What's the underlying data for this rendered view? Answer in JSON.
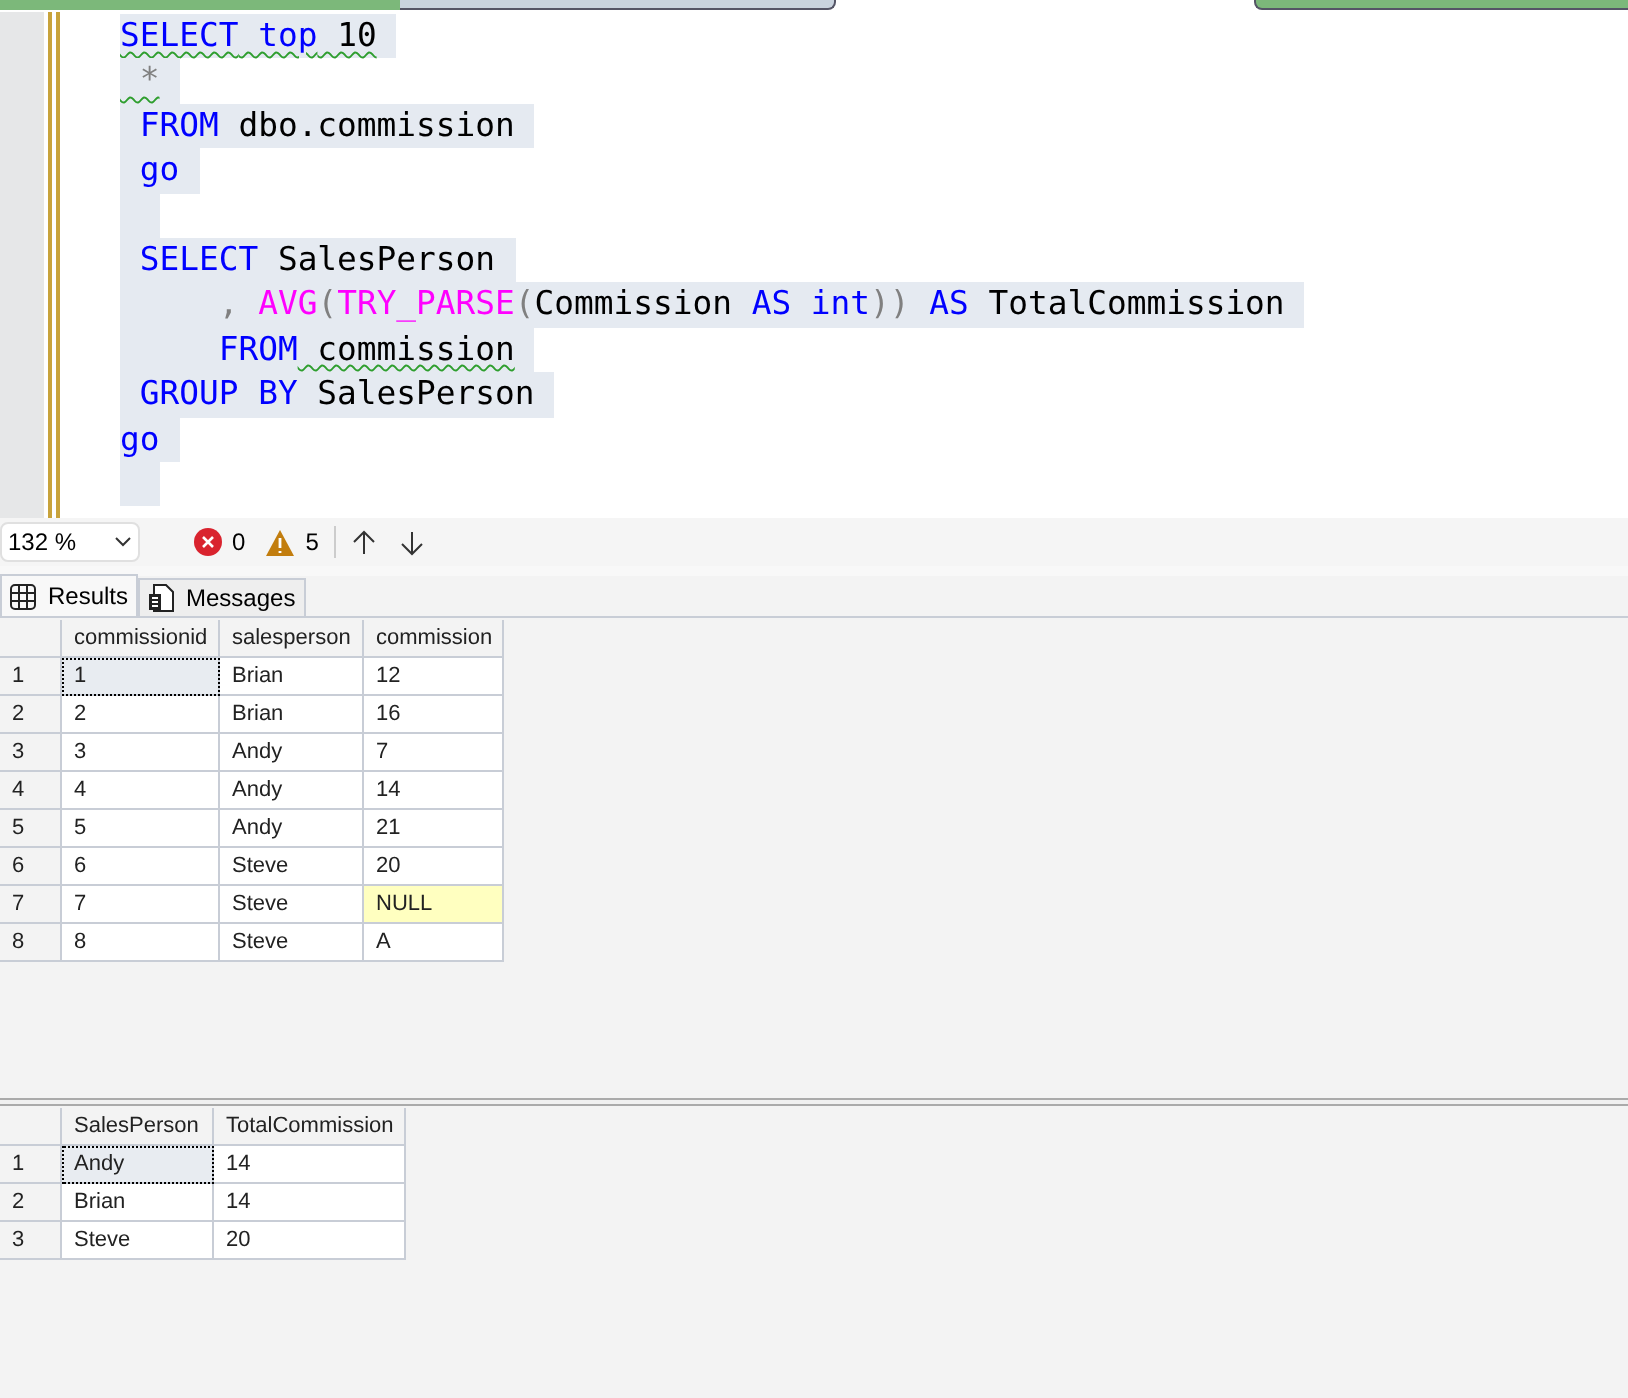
{
  "editor": {
    "lines": [
      {
        "tokens": [
          {
            "text": "SELECT",
            "kind": "keyword",
            "squiggle": true
          },
          {
            "text": " top",
            "kind": "keyword",
            "squiggle": true
          },
          {
            "text": " 10",
            "kind": "plain",
            "squiggle": true
          }
        ]
      },
      {
        "tokens": [
          {
            "text": " *",
            "kind": "punct",
            "squiggle": true
          }
        ]
      },
      {
        "tokens": [
          {
            "text": " FROM",
            "kind": "keyword",
            "squiggle": false
          },
          {
            "text": " dbo.commission",
            "kind": "plain",
            "squiggle": false
          }
        ]
      },
      {
        "tokens": [
          {
            "text": " go",
            "kind": "keyword",
            "squiggle": false
          }
        ]
      },
      {
        "blank": true
      },
      {
        "tokens": [
          {
            "text": " SELECT",
            "kind": "keyword",
            "squiggle": false
          },
          {
            "text": " SalesPerson",
            "kind": "plain",
            "squiggle": false
          }
        ]
      },
      {
        "tokens": [
          {
            "text": "     ,",
            "kind": "punct",
            "squiggle": false
          },
          {
            "text": " AVG",
            "kind": "function",
            "squiggle": false
          },
          {
            "text": "(",
            "kind": "punct",
            "squiggle": false
          },
          {
            "text": "TRY_PARSE",
            "kind": "function",
            "squiggle": false
          },
          {
            "text": "(",
            "kind": "punct",
            "squiggle": false
          },
          {
            "text": "Commission",
            "kind": "plain",
            "squiggle": false
          },
          {
            "text": " AS",
            "kind": "keyword",
            "squiggle": false
          },
          {
            "text": " int",
            "kind": "keyword",
            "squiggle": false
          },
          {
            "text": "))",
            "kind": "punct",
            "squiggle": false
          },
          {
            "text": " AS",
            "kind": "keyword",
            "squiggle": false
          },
          {
            "text": " TotalCommission",
            "kind": "plain",
            "squiggle": false
          }
        ]
      },
      {
        "tokens": [
          {
            "text": "     FROM",
            "kind": "keyword",
            "squiggle": false
          },
          {
            "text": " commission",
            "kind": "plain",
            "squiggle": true
          }
        ]
      },
      {
        "tokens": [
          {
            "text": " GROUP BY",
            "kind": "keyword",
            "squiggle": false
          },
          {
            "text": " SalesPerson",
            "kind": "plain",
            "squiggle": false
          }
        ]
      },
      {
        "tokens": [
          {
            "text": "go",
            "kind": "keyword",
            "squiggle": false
          }
        ]
      },
      {
        "blank": true
      }
    ]
  },
  "status": {
    "zoom": "132 %",
    "errors": "0",
    "warnings": "5"
  },
  "tabs": [
    {
      "label": "Results",
      "selected": true,
      "kind": "grid"
    },
    {
      "label": "Messages",
      "selected": false,
      "kind": "doc"
    }
  ],
  "grids": [
    {
      "columns": [
        "commissionid",
        "salesperson",
        "commission"
      ],
      "rows": [
        {
          "number": "1",
          "focused": true,
          "cells": [
            {
              "text": "1",
              "kind": "value"
            },
            {
              "text": "Brian",
              "kind": "value"
            },
            {
              "text": "12",
              "kind": "value"
            }
          ]
        },
        {
          "number": "2",
          "focused": false,
          "cells": [
            {
              "text": "2",
              "kind": "value"
            },
            {
              "text": "Brian",
              "kind": "value"
            },
            {
              "text": "16",
              "kind": "value"
            }
          ]
        },
        {
          "number": "3",
          "focused": false,
          "cells": [
            {
              "text": "3",
              "kind": "value"
            },
            {
              "text": "Andy",
              "kind": "value"
            },
            {
              "text": "7",
              "kind": "value"
            }
          ]
        },
        {
          "number": "4",
          "focused": false,
          "cells": [
            {
              "text": "4",
              "kind": "value"
            },
            {
              "text": "Andy",
              "kind": "value"
            },
            {
              "text": "14",
              "kind": "value"
            }
          ]
        },
        {
          "number": "5",
          "focused": false,
          "cells": [
            {
              "text": "5",
              "kind": "value"
            },
            {
              "text": "Andy",
              "kind": "value"
            },
            {
              "text": "21",
              "kind": "value"
            }
          ]
        },
        {
          "number": "6",
          "focused": false,
          "cells": [
            {
              "text": "6",
              "kind": "value"
            },
            {
              "text": "Steve",
              "kind": "value"
            },
            {
              "text": "20",
              "kind": "value"
            }
          ]
        },
        {
          "number": "7",
          "focused": false,
          "cells": [
            {
              "text": "7",
              "kind": "value"
            },
            {
              "text": "Steve",
              "kind": "value"
            },
            {
              "text": "NULL",
              "kind": "null"
            }
          ]
        },
        {
          "number": "8",
          "focused": false,
          "cells": [
            {
              "text": "8",
              "kind": "value"
            },
            {
              "text": "Steve",
              "kind": "value"
            },
            {
              "text": "A",
              "kind": "value"
            }
          ]
        }
      ]
    },
    {
      "columns": [
        "SalesPerson",
        "TotalCommission"
      ],
      "rows": [
        {
          "number": "1",
          "focused": true,
          "cells": [
            {
              "text": "Andy",
              "kind": "value"
            },
            {
              "text": "14",
              "kind": "value"
            }
          ]
        },
        {
          "number": "2",
          "focused": false,
          "cells": [
            {
              "text": "Brian",
              "kind": "value"
            },
            {
              "text": "14",
              "kind": "value"
            }
          ]
        },
        {
          "number": "3",
          "focused": false,
          "cells": [
            {
              "text": "Steve",
              "kind": "value"
            },
            {
              "text": "20",
              "kind": "value"
            }
          ]
        }
      ]
    }
  ]
}
